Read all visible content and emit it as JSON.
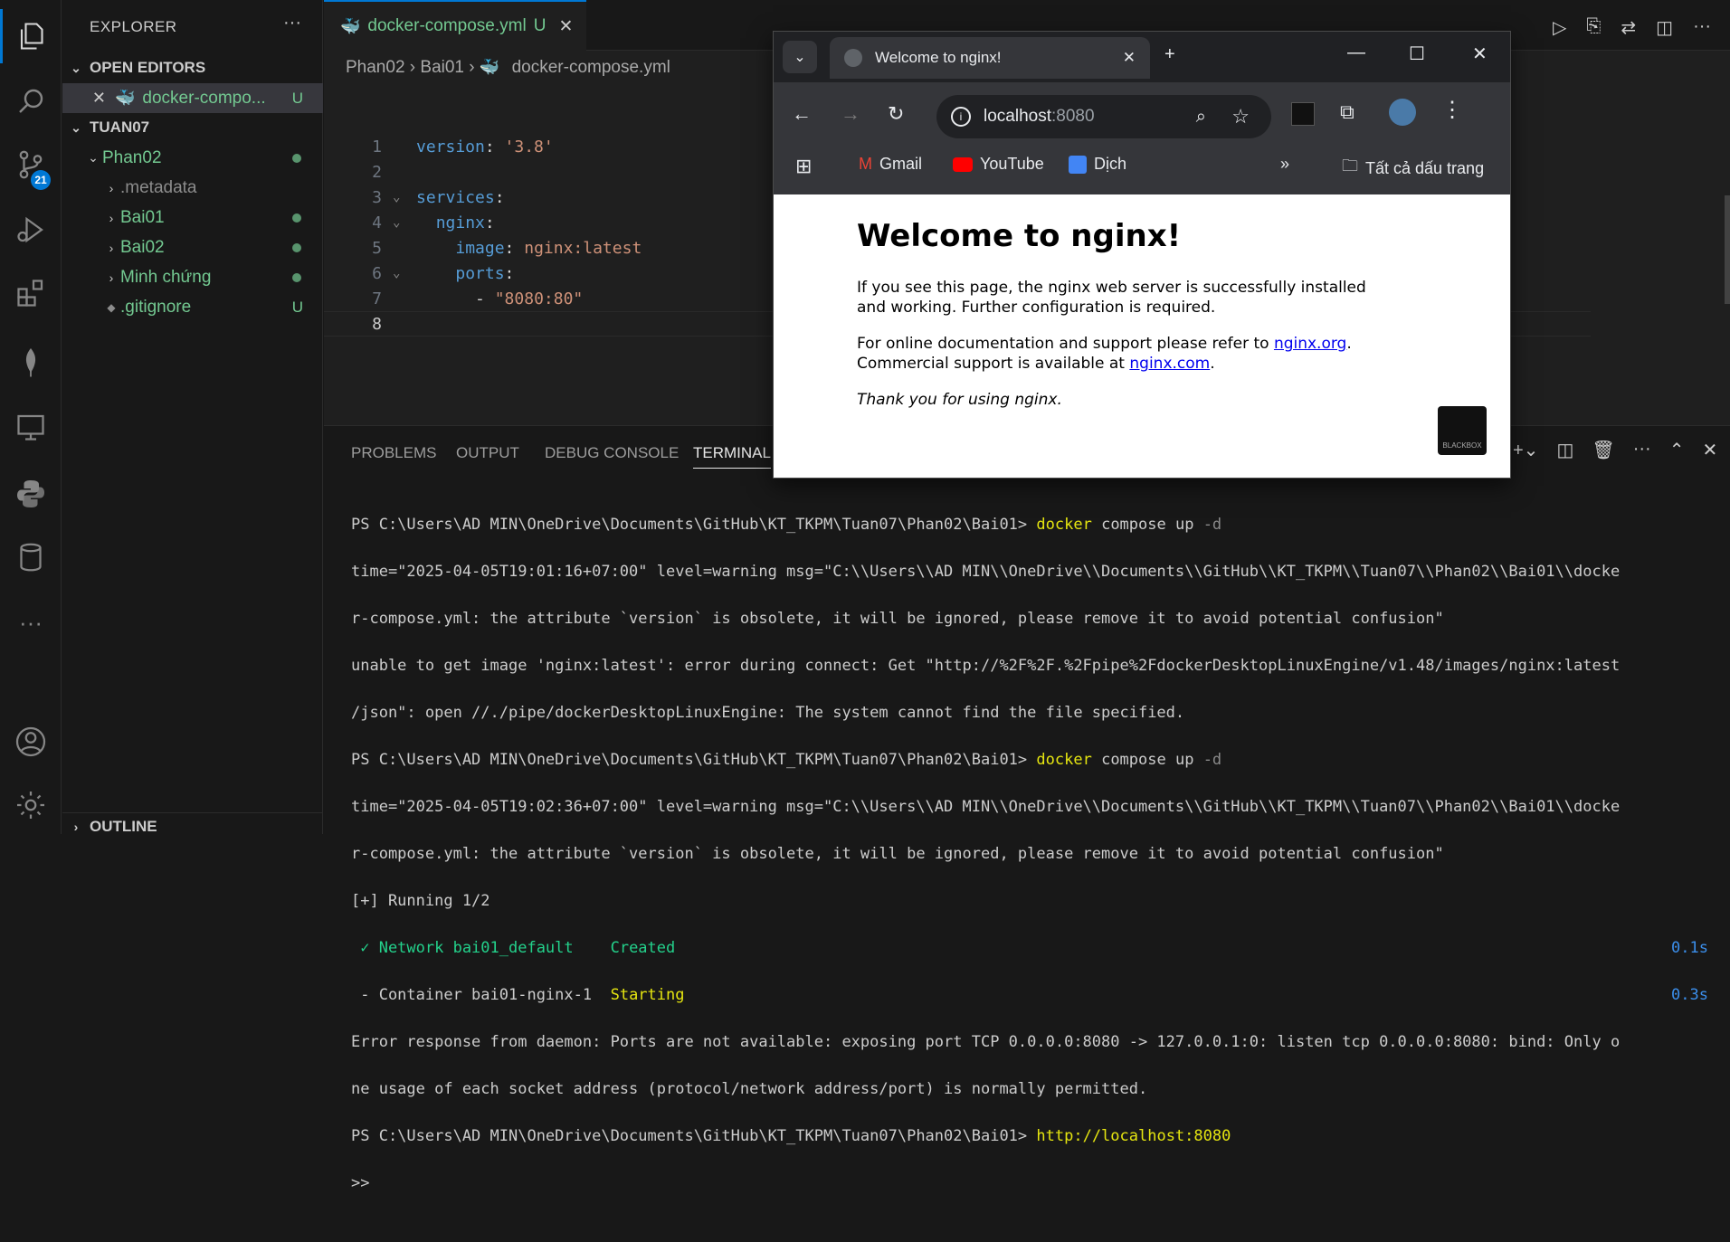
{
  "sidebar": {
    "title": "EXPLORER",
    "open_editors": "OPEN EDITORS",
    "open_file": "docker-compo...",
    "open_file_status": "U",
    "workspace": "TUAN07",
    "items": [
      {
        "label": "Phan02"
      },
      {
        "label": ".metadata"
      },
      {
        "label": "Bai01"
      },
      {
        "label": "Bai02"
      },
      {
        "label": "Minh chứng"
      },
      {
        "label": ".gitignore",
        "status": "U"
      }
    ],
    "outline": "OUTLINE"
  },
  "activity": {
    "scm_badge": "21"
  },
  "editor": {
    "tab_label": "docker-compose.yml",
    "tab_status": "U",
    "breadcrumb": [
      "Phan02",
      "Bai01",
      "docker-compose.yml"
    ],
    "lines": [
      {
        "n": "1",
        "key": "version",
        "val": "'3.8'"
      },
      {
        "n": "2"
      },
      {
        "n": "3",
        "key": "services"
      },
      {
        "n": "4",
        "key": "nginx"
      },
      {
        "n": "5",
        "key": "image",
        "val": "nginx:latest"
      },
      {
        "n": "6",
        "key": "ports"
      },
      {
        "n": "7",
        "val": "\"8080:80\""
      },
      {
        "n": "8"
      }
    ]
  },
  "panel": {
    "tabs": [
      "PROBLEMS",
      "OUTPUT",
      "DEBUG CONSOLE",
      "TERMINAL"
    ],
    "terminal": {
      "prompt": "PS C:\\Users\\AD MIN\\OneDrive\\Documents\\GitHub\\KT_TKPM\\Tuan07\\Phan02\\Bai01>",
      "cmd1": "docker",
      "cmd1_rest": "compose up",
      "flag": "-d",
      "warn1": "time=\"2025-04-05T19:01:16+07:00\" level=warning msg=\"C:\\\\Users\\\\AD MIN\\\\OneDrive\\\\Documents\\\\GitHub\\\\KT_TKPM\\\\Tuan07\\\\Phan02\\\\Bai01\\\\docke",
      "warn1b": "r-compose.yml: the attribute `version` is obsolete, it will be ignored, please remove it to avoid potential confusion\"",
      "err1": "unable to get image 'nginx:latest': error during connect: Get \"http://%2F%2F.%2Fpipe%2FdockerDesktopLinuxEngine/v1.48/images/nginx:latest",
      "err1b": "/json\": open //./pipe/dockerDesktopLinuxEngine: The system cannot find the file specified.",
      "warn2": "time=\"2025-04-05T19:02:36+07:00\" level=warning msg=\"C:\\\\Users\\\\AD MIN\\\\OneDrive\\\\Documents\\\\GitHub\\\\KT_TKPM\\\\Tuan07\\\\Phan02\\\\Bai01\\\\docke",
      "warn2b": "r-compose.yml: the attribute `version` is obsolete, it will be ignored, please remove it to avoid potential confusion\"",
      "running": "[+] Running 1/2",
      "net_label": " ✓ Network bai01_default",
      "net_status": "Created",
      "net_time": "0.1s",
      "cont_label": " - Container bai01-nginx-1",
      "cont_status": "Starting",
      "cont_time": "0.3s",
      "err2": "Error response from daemon: Ports are not available: exposing port TCP 0.0.0.0:8080 -> 127.0.0.1:0: listen tcp 0.0.0.0:8080: bind: Only o",
      "err2b": "ne usage of each socket address (protocol/network address/port) is normally permitted.",
      "link": "http://localhost:8080",
      "cursor": ">>"
    }
  },
  "browser": {
    "tab_title": "Welcome to nginx!",
    "url_host": "localhost",
    "url_port": ":8080",
    "bookmarks": [
      "Gmail",
      "YouTube",
      "Dịch"
    ],
    "all_bookmarks": "Tất cả dấu trang",
    "page": {
      "heading": "Welcome to nginx!",
      "p1": "If you see this page, the nginx web server is successfully installed and working. Further configuration is required.",
      "p2a": "For online documentation and support please refer to ",
      "link1": "nginx.org",
      "p2b": "Commercial support is available at ",
      "link2": "nginx.com",
      "p3": "Thank you for using nginx."
    },
    "ext_label": "BLACKBOX"
  }
}
